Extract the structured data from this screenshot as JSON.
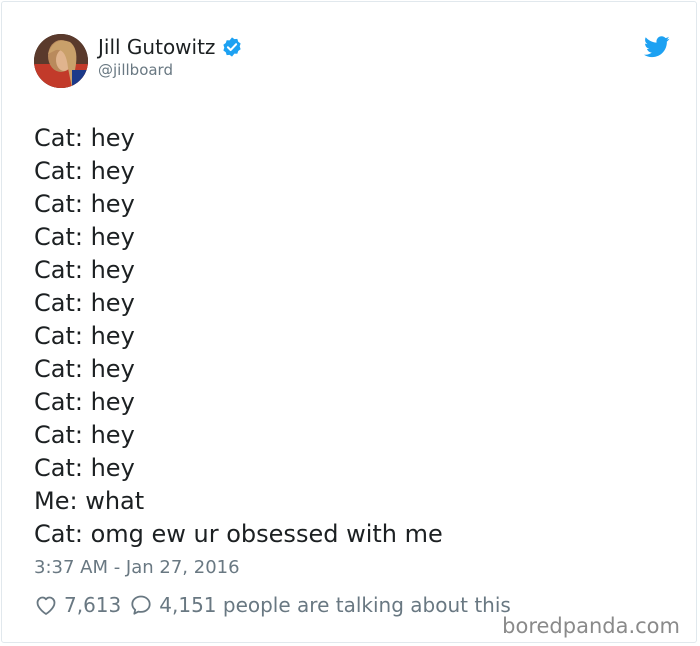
{
  "author": {
    "display_name": "Jill Gutowitz",
    "handle": "@jillboard",
    "avatar_icon": "profile-photo",
    "verified_icon": "verified-badge-icon",
    "verified_color": "#1da1f2"
  },
  "platform_icon": "twitter-bird-icon",
  "tweet_lines": [
    "Cat: hey",
    "Cat: hey",
    "Cat: hey",
    "Cat: hey",
    "Cat: hey",
    "Cat: hey",
    "Cat: hey",
    "Cat: hey",
    "Cat: hey",
    "Cat: hey",
    "Cat: hey",
    "Me: what",
    "Cat: omg ew ur obsessed with me"
  ],
  "timestamp": "3:37 AM - Jan 27, 2016",
  "stats": {
    "likes": "7,613",
    "like_icon": "heart-icon",
    "replies_label": "4,151 people are talking about this",
    "reply_icon": "speech-bubble-icon"
  },
  "watermark": "boredpanda.com"
}
